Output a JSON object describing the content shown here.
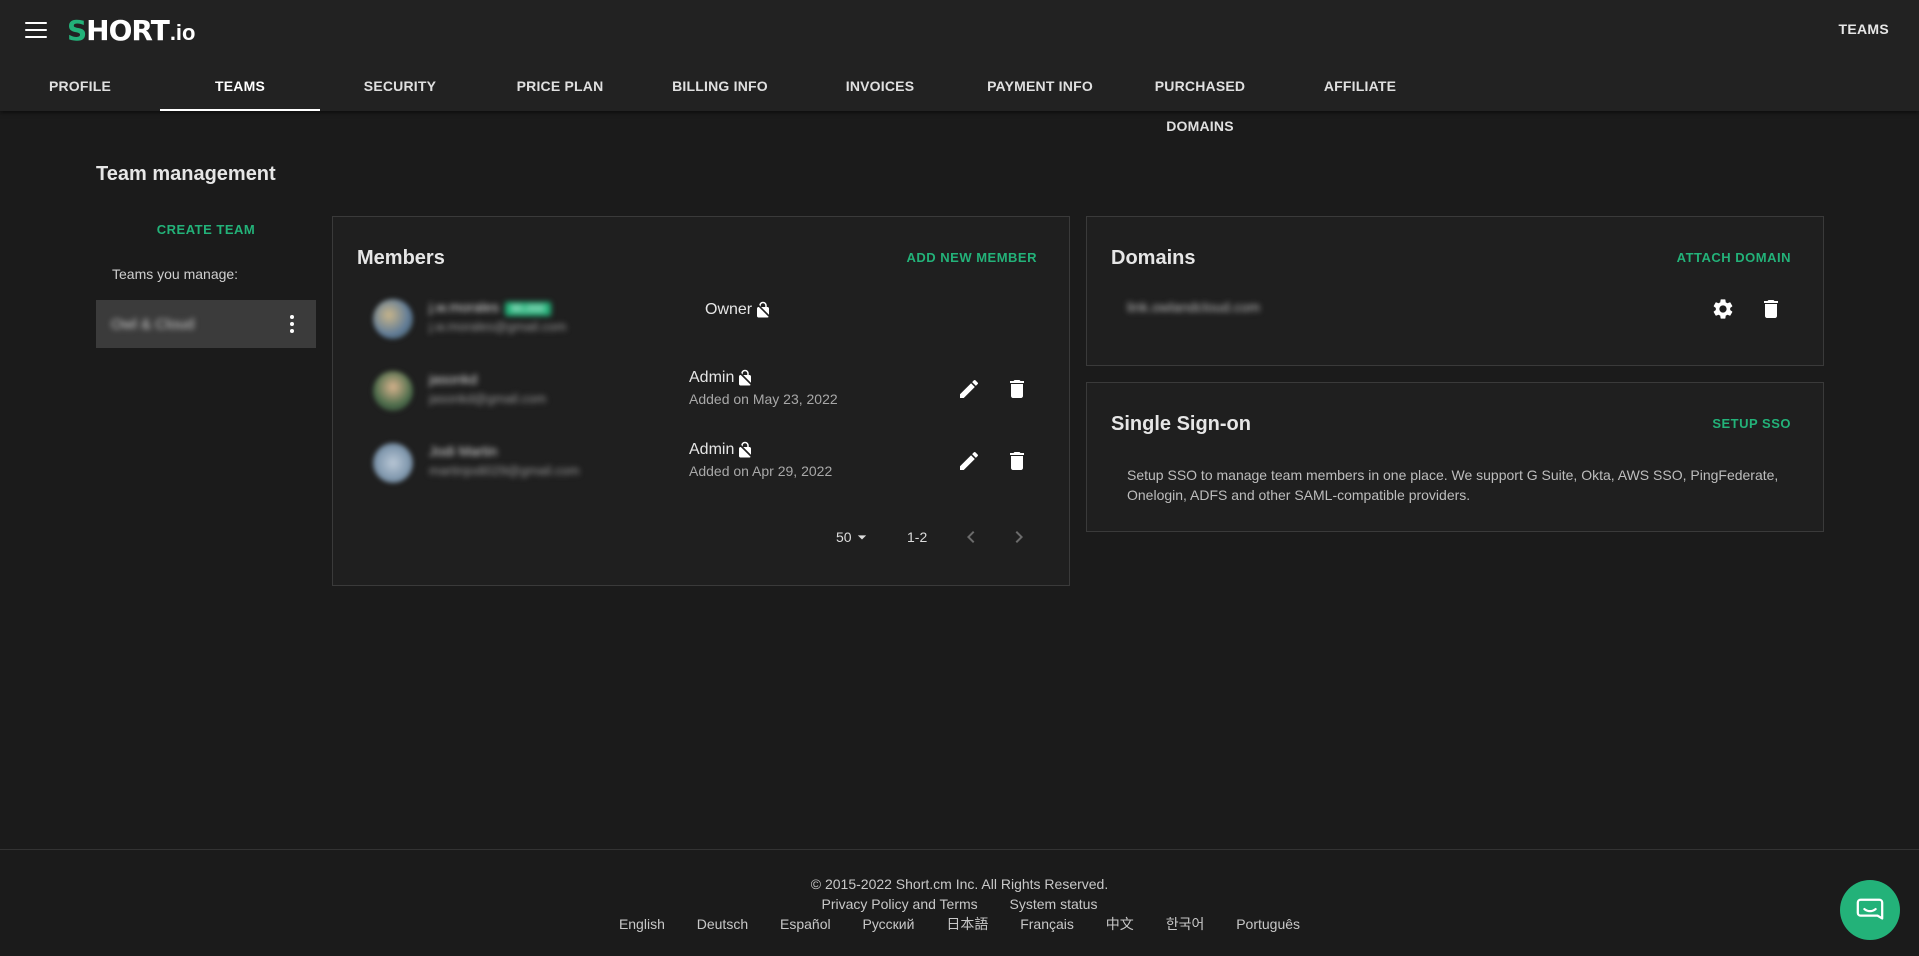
{
  "header": {
    "logo_text": "SHORT",
    "logo_suffix": ".io",
    "right_label": "TEAMS"
  },
  "tabs": [
    {
      "label": "PROFILE"
    },
    {
      "label": "TEAMS",
      "active": true
    },
    {
      "label": "SECURITY"
    },
    {
      "label": "PRICE PLAN"
    },
    {
      "label": "BILLING INFO"
    },
    {
      "label": "INVOICES"
    },
    {
      "label": "PAYMENT INFO"
    },
    {
      "label": "PURCHASED DOMAINS"
    },
    {
      "label": "AFFILIATE"
    }
  ],
  "page": {
    "title": "Team management"
  },
  "sidebar": {
    "create_label": "CREATE TEAM",
    "teams_label": "Teams you manage:",
    "team_name": "Owl & Cloud"
  },
  "members": {
    "title": "Members",
    "action": "ADD NEW MEMBER",
    "rows": [
      {
        "name": "j.w.morales",
        "badge": "90,000",
        "email": "j.w.morales@gmail.com",
        "role": "Owner",
        "added": ""
      },
      {
        "name": "jasonkd",
        "email": "jasonkd@gmail.com",
        "role": "Admin",
        "added": "Added on May 23, 2022"
      },
      {
        "name": "Jodi Martin",
        "email": "martinjodi029@gmail.com",
        "role": "Admin",
        "added": "Added on Apr 29, 2022"
      }
    ],
    "pager": {
      "page_size": "50",
      "range": "1-2"
    }
  },
  "domains": {
    "title": "Domains",
    "action": "ATTACH DOMAIN",
    "items": [
      {
        "name": "link.owlandcloud.com"
      }
    ]
  },
  "sso": {
    "title": "Single Sign-on",
    "action": "SETUP SSO",
    "description": "Setup SSO to manage team members in one place. We support G Suite, Okta, AWS SSO, PingFederate, Onelogin, ADFS and other SAML-compatible providers."
  },
  "footer": {
    "copyright": "© 2015-2022  Short.cm Inc. All Rights Reserved.",
    "links": [
      "Privacy Policy and Terms",
      "System status"
    ],
    "languages": [
      "English",
      "Deutsch",
      "Español",
      "Русский",
      "日本語",
      "Français",
      "中文",
      "한국어",
      "Português"
    ]
  },
  "colors": {
    "accent": "#23b279",
    "background": "#1b1b1b",
    "header": "#222222"
  },
  "icons": {
    "menu": "menu-icon",
    "kebab": "more-vert-icon",
    "lock": "lock-icon",
    "edit": "pencil-icon",
    "delete": "trash-icon",
    "settings": "gear-icon",
    "chat": "chat-icon"
  }
}
